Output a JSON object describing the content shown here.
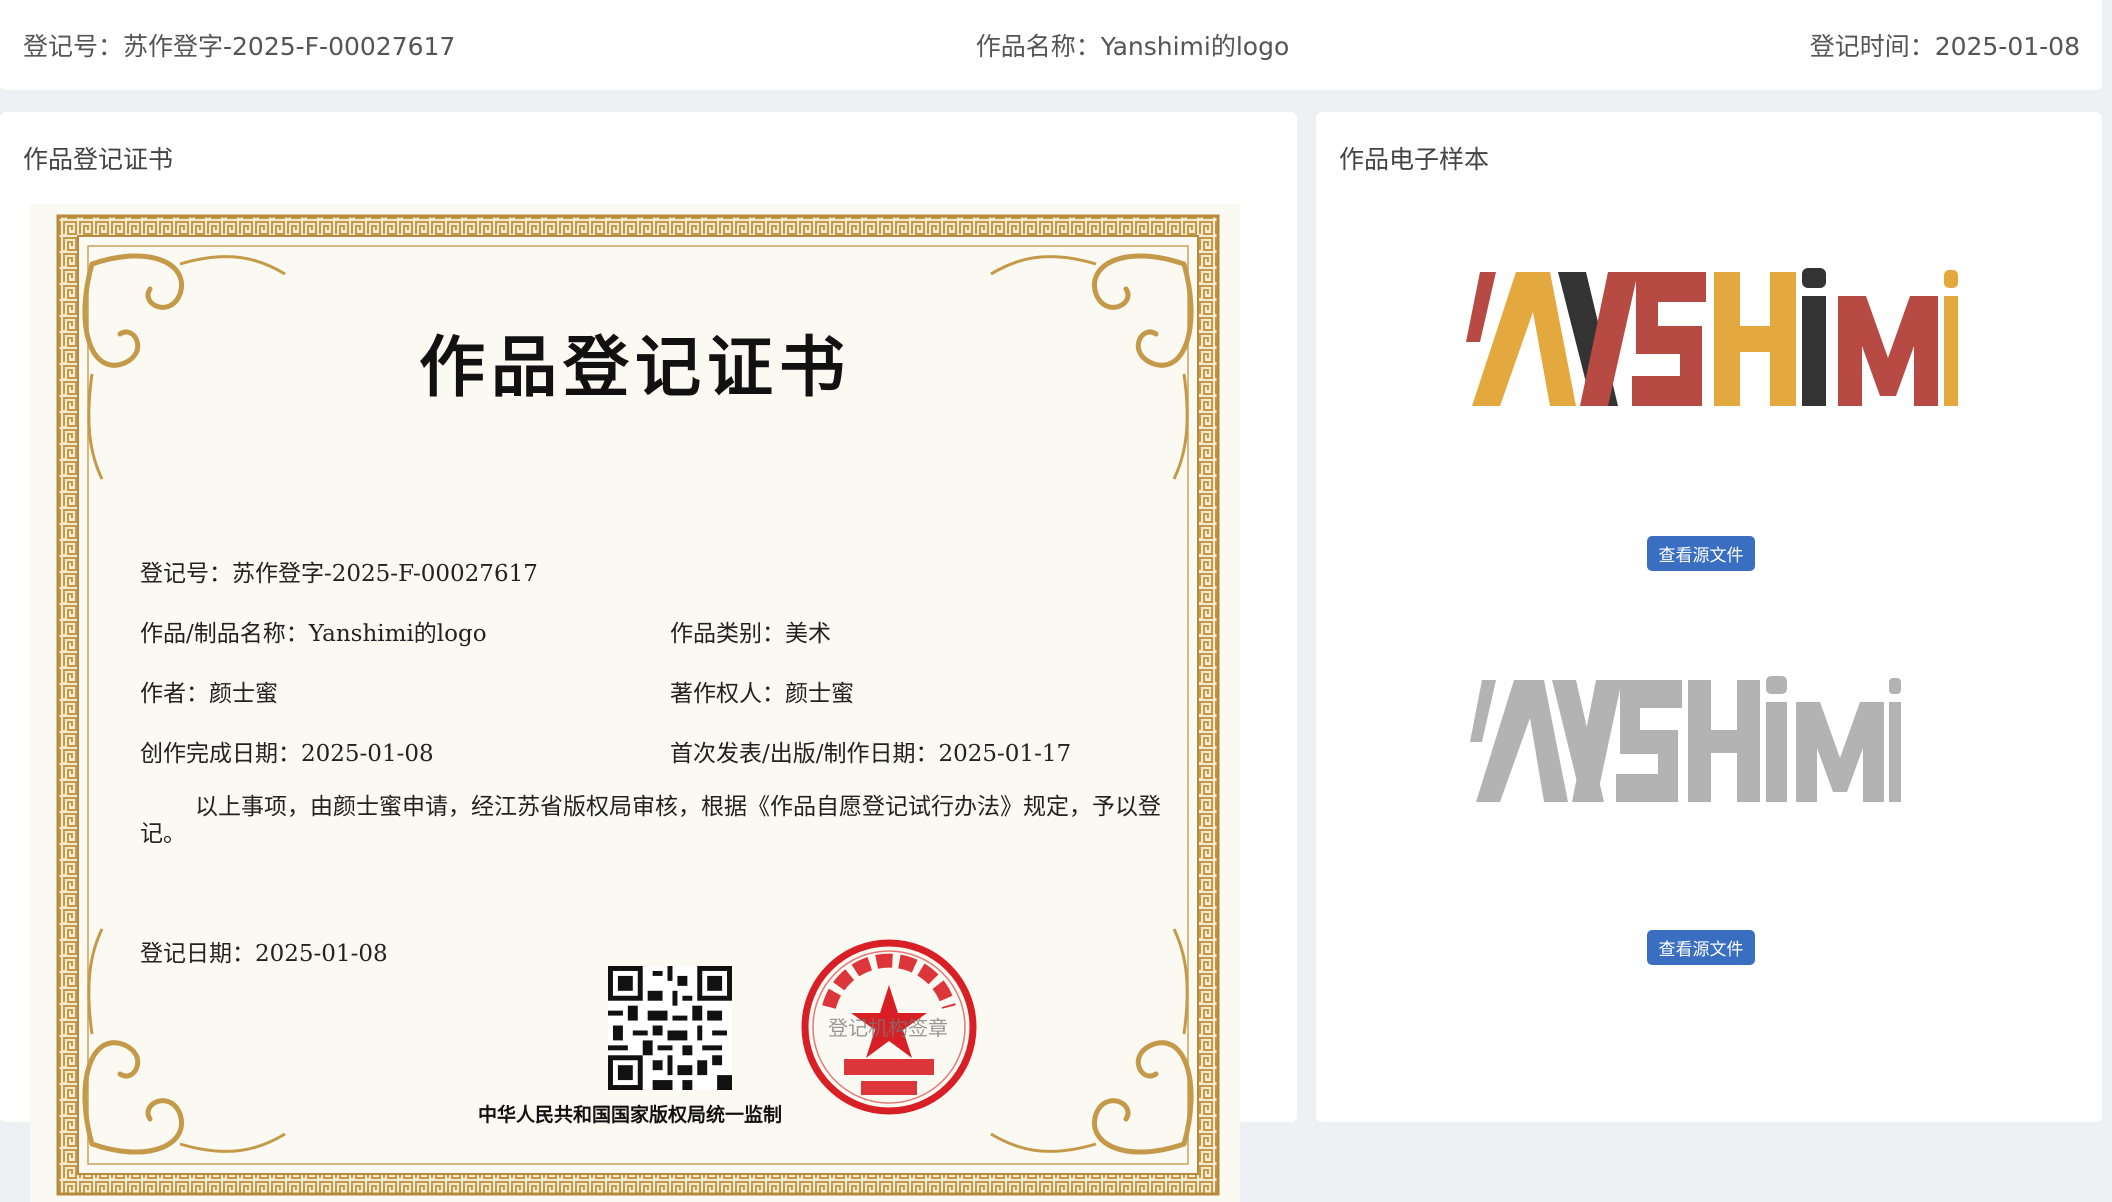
{
  "header": {
    "reg_no": "登记号：苏作登字-2025-F-00027617",
    "work_name": "作品名称：Yanshimi的logo",
    "reg_time": "登记时间：2025-01-08"
  },
  "cert_panel": {
    "title": "作品登记证书"
  },
  "certificate": {
    "heading": "作品登记证书",
    "reg_no": "登记号：苏作登字-2025-F-00027617",
    "work_name": "作品/制品名称：Yanshimi的logo",
    "work_category": "作品类别：美术",
    "author": "作者：颜士蜜",
    "copyright_owner": "著作权人：颜士蜜",
    "creation_date": "创作完成日期：2025-01-08",
    "publication_date": "首次发表/出版/制作日期：2025-01-17",
    "statement": "以上事项，由颜士蜜申请，经江苏省版权局审核，根据《作品自愿登记试行办法》规定，予以登记。",
    "reg_date": "登记日期：2025-01-08",
    "seal_text": "登记机构签章",
    "footer": "中华人民共和国国家版权局统一监制"
  },
  "sample_panel": {
    "title": "作品电子样本",
    "view_source_1": "查看源文件",
    "view_source_2": "查看源文件"
  },
  "colors": {
    "button": "#3a6ec0",
    "logo_red": "#b84a44",
    "logo_gold": "#e3a93f",
    "logo_dark": "#333333",
    "seal_red": "#d81f26",
    "frame_gold": "#c49a4a"
  }
}
